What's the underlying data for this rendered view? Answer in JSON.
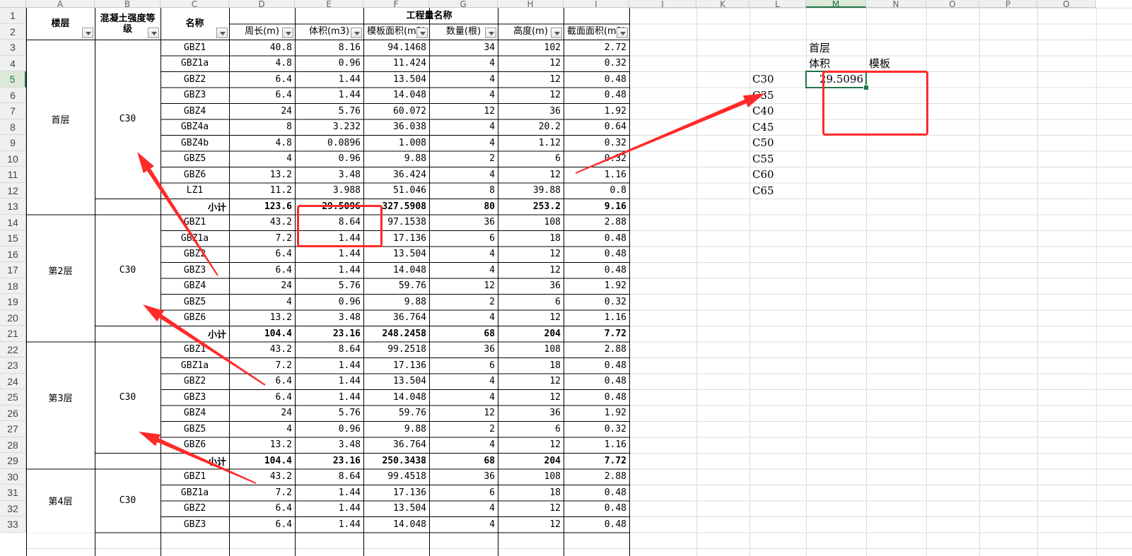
{
  "columns": {
    "letters": [
      "A",
      "B",
      "C",
      "D",
      "E",
      "F",
      "G",
      "H",
      "I",
      "J",
      "K",
      "L",
      "M",
      "N",
      "O",
      "P",
      "Q"
    ],
    "selected": "M"
  },
  "rows": {
    "first": 1,
    "last": 33,
    "selected": 5
  },
  "table": {
    "header": {
      "floor": "楼层",
      "grade": "混凝土强度等级",
      "name": "名称",
      "group": "工程量名称",
      "perimeter": "周长(m)",
      "volume": "体积(m3)",
      "formwork": "模板面积(m2)",
      "count": "数量(根)",
      "height": "高度(m)",
      "section": "截面面积(m2)"
    },
    "subtotal_label": "小计",
    "groups": [
      {
        "floor": "首层",
        "grade": "C30",
        "rows": [
          [
            "GBZ1",
            "40.8",
            "8.16",
            "94.1468",
            "34",
            "102",
            "2.72"
          ],
          [
            "GBZ1a",
            "4.8",
            "0.96",
            "11.424",
            "4",
            "12",
            "0.32"
          ],
          [
            "GBZ2",
            "6.4",
            "1.44",
            "13.504",
            "4",
            "12",
            "0.48"
          ],
          [
            "GBZ3",
            "6.4",
            "1.44",
            "14.048",
            "4",
            "12",
            "0.48"
          ],
          [
            "GBZ4",
            "24",
            "5.76",
            "60.072",
            "12",
            "36",
            "1.92"
          ],
          [
            "GBZ4a",
            "8",
            "3.232",
            "36.038",
            "4",
            "20.2",
            "0.64"
          ],
          [
            "GBZ4b",
            "4.8",
            "0.0896",
            "1.008",
            "4",
            "1.12",
            "0.32"
          ],
          [
            "GBZ5",
            "4",
            "0.96",
            "9.88",
            "2",
            "6",
            "0.32"
          ],
          [
            "GBZ6",
            "13.2",
            "3.48",
            "36.424",
            "4",
            "12",
            "1.16"
          ],
          [
            "LZ1",
            "11.2",
            "3.988",
            "51.046",
            "8",
            "39.88",
            "0.8"
          ]
        ],
        "subtotal": [
          "123.6",
          "29.5096",
          "327.5908",
          "80",
          "253.2",
          "9.16"
        ]
      },
      {
        "floor": "第2层",
        "grade": "C30",
        "rows": [
          [
            "GBZ1",
            "43.2",
            "8.64",
            "97.1538",
            "36",
            "108",
            "2.88"
          ],
          [
            "GBZ1a",
            "7.2",
            "1.44",
            "17.136",
            "6",
            "18",
            "0.48"
          ],
          [
            "GBZ2",
            "6.4",
            "1.44",
            "13.504",
            "4",
            "12",
            "0.48"
          ],
          [
            "GBZ3",
            "6.4",
            "1.44",
            "14.048",
            "4",
            "12",
            "0.48"
          ],
          [
            "GBZ4",
            "24",
            "5.76",
            "59.76",
            "12",
            "36",
            "1.92"
          ],
          [
            "GBZ5",
            "4",
            "0.96",
            "9.88",
            "2",
            "6",
            "0.32"
          ],
          [
            "GBZ6",
            "13.2",
            "3.48",
            "36.764",
            "4",
            "12",
            "1.16"
          ]
        ],
        "subtotal": [
          "104.4",
          "23.16",
          "248.2458",
          "68",
          "204",
          "7.72"
        ]
      },
      {
        "floor": "第3层",
        "grade": "C30",
        "rows": [
          [
            "GBZ1",
            "43.2",
            "8.64",
            "99.2518",
            "36",
            "108",
            "2.88"
          ],
          [
            "GBZ1a",
            "7.2",
            "1.44",
            "17.136",
            "6",
            "18",
            "0.48"
          ],
          [
            "GBZ2",
            "6.4",
            "1.44",
            "13.504",
            "4",
            "12",
            "0.48"
          ],
          [
            "GBZ3",
            "6.4",
            "1.44",
            "14.048",
            "4",
            "12",
            "0.48"
          ],
          [
            "GBZ4",
            "24",
            "5.76",
            "59.76",
            "12",
            "36",
            "1.92"
          ],
          [
            "GBZ5",
            "4",
            "0.96",
            "9.88",
            "2",
            "6",
            "0.32"
          ],
          [
            "GBZ6",
            "13.2",
            "3.48",
            "36.764",
            "4",
            "12",
            "1.16"
          ]
        ],
        "subtotal": [
          "104.4",
          "23.16",
          "250.3438",
          "68",
          "204",
          "7.72"
        ]
      },
      {
        "floor": "第4层",
        "grade": "C30",
        "rows": [
          [
            "GBZ1",
            "43.2",
            "8.64",
            "99.4518",
            "36",
            "108",
            "2.88"
          ],
          [
            "GBZ1a",
            "7.2",
            "1.44",
            "17.136",
            "6",
            "18",
            "0.48"
          ],
          [
            "GBZ2",
            "6.4",
            "1.44",
            "13.504",
            "4",
            "12",
            "0.48"
          ],
          [
            "GBZ3",
            "6.4",
            "1.44",
            "14.048",
            "4",
            "12",
            "0.48"
          ]
        ],
        "subtotal": null
      }
    ]
  },
  "side": {
    "title": "首层",
    "volume_label": "体积",
    "formwork_label": "模板",
    "grades": [
      "C30",
      "C35",
      "C40",
      "C45",
      "C50",
      "C55",
      "C60",
      "C65"
    ],
    "selected_value": "29.5096"
  },
  "colors": {
    "annotation": "#ff2a2a",
    "selection": "#217346",
    "grid": "#d8d8d8",
    "header_bg": "#eef0f2"
  },
  "icons": [
    "filter-dropdown-icon"
  ]
}
